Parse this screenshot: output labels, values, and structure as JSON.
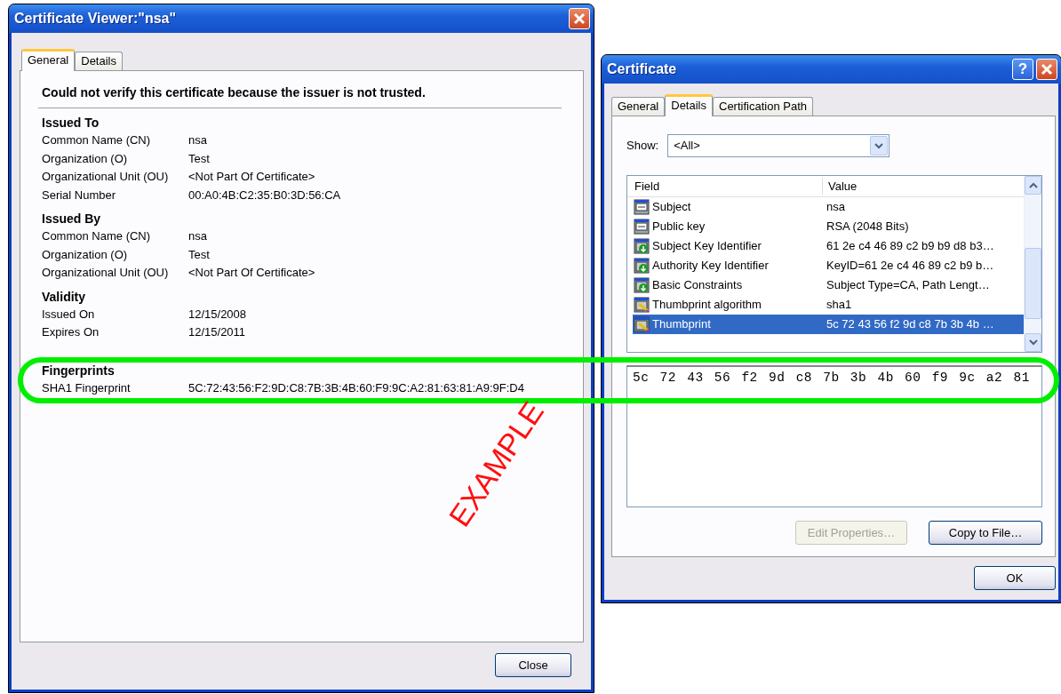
{
  "viewer": {
    "title": "Certificate Viewer:\"nsa\"",
    "tabs": [
      {
        "label": "General",
        "selected": true
      },
      {
        "label": "Details",
        "selected": false
      }
    ],
    "warning": "Could not verify this certificate because the issuer is not trusted.",
    "sections": [
      {
        "heading": "Issued To",
        "rows": [
          {
            "label": "Common Name (CN)",
            "value": "nsa"
          },
          {
            "label": "Organization (O)",
            "value": "Test"
          },
          {
            "label": "Organizational Unit (OU)",
            "value": "<Not Part Of Certificate>"
          },
          {
            "label": "Serial Number",
            "value": "00:A0:4B:C2:35:B0:3D:56:CA"
          }
        ]
      },
      {
        "heading": "Issued By",
        "rows": [
          {
            "label": "Common Name (CN)",
            "value": "nsa"
          },
          {
            "label": "Organization (O)",
            "value": "Test"
          },
          {
            "label": "Organizational Unit (OU)",
            "value": "<Not Part Of Certificate>"
          }
        ]
      },
      {
        "heading": "Validity",
        "rows": [
          {
            "label": "Issued On",
            "value": "12/15/2008"
          },
          {
            "label": "Expires On",
            "value": "12/15/2011"
          }
        ]
      },
      {
        "heading": "Fingerprints",
        "rows": [
          {
            "label": "SHA1 Fingerprint",
            "value": "5C:72:43:56:F2:9D:C8:7B:3B:4B:60:F9:9C:A2:81:63:81:A9:9F:D4"
          }
        ]
      }
    ],
    "close_button": "Close"
  },
  "certificate": {
    "title": "Certificate",
    "help_button": "?",
    "tabs": [
      {
        "label": "General",
        "selected": false
      },
      {
        "label": "Details",
        "selected": true
      },
      {
        "label": "Certification Path",
        "selected": false
      }
    ],
    "show_label": "Show:",
    "show_value": "<All>",
    "columns": [
      "Field",
      "Value"
    ],
    "rows": [
      {
        "kind": "plain",
        "field": "Subject",
        "value": "nsa",
        "selected": false
      },
      {
        "kind": "plain",
        "field": "Public key",
        "value": "RSA (2048 Bits)",
        "selected": false
      },
      {
        "kind": "extension",
        "field": "Subject Key Identifier",
        "value": "61 2e c4 46 89 c2 b9 b9 d8 b3…",
        "selected": false
      },
      {
        "kind": "extension",
        "field": "Authority Key Identifier",
        "value": "KeyID=61 2e c4 46 89 c2 b9 b…",
        "selected": false
      },
      {
        "kind": "extension",
        "field": "Basic Constraints",
        "value": "Subject Type=CA, Path Lengt…",
        "selected": false
      },
      {
        "kind": "thumbprint",
        "field": "Thumbprint algorithm",
        "value": "sha1",
        "selected": false
      },
      {
        "kind": "thumbprint",
        "field": "Thumbprint",
        "value": "5c 72 43 56 f2 9d c8 7b 3b 4b …",
        "selected": true
      }
    ],
    "detail_value": "5c 72 43 56 f2 9d c8 7b 3b 4b 60 f9 9c a2 81",
    "buttons": [
      {
        "label": "Edit Properties…",
        "disabled": true
      },
      {
        "label": "Copy to File…",
        "disabled": false
      }
    ],
    "ok_button": "OK"
  },
  "annotation": {
    "text": "EXAMPLE"
  }
}
